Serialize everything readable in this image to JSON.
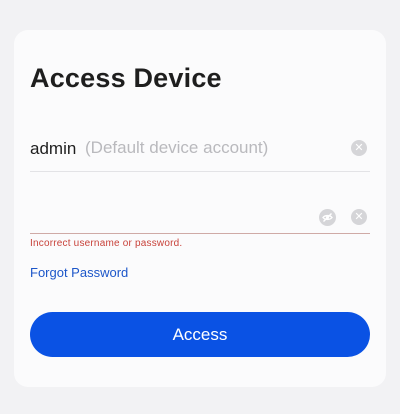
{
  "title": "Access Device",
  "username": {
    "value": "admin",
    "hint": "(Default device account)",
    "clear_icon": "clear-circle-icon"
  },
  "password": {
    "value": "",
    "toggle_icon": "eye-hidden-icon",
    "clear_icon": "clear-circle-icon"
  },
  "error": "Incorrect username or password.",
  "forgot_password": "Forgot Password",
  "access_button": "Access",
  "colors": {
    "primary": "#0a52e4",
    "link": "#1c56c9",
    "error": "#c8423a",
    "background": "#f2f2f4",
    "card": "#fbfbfc"
  }
}
